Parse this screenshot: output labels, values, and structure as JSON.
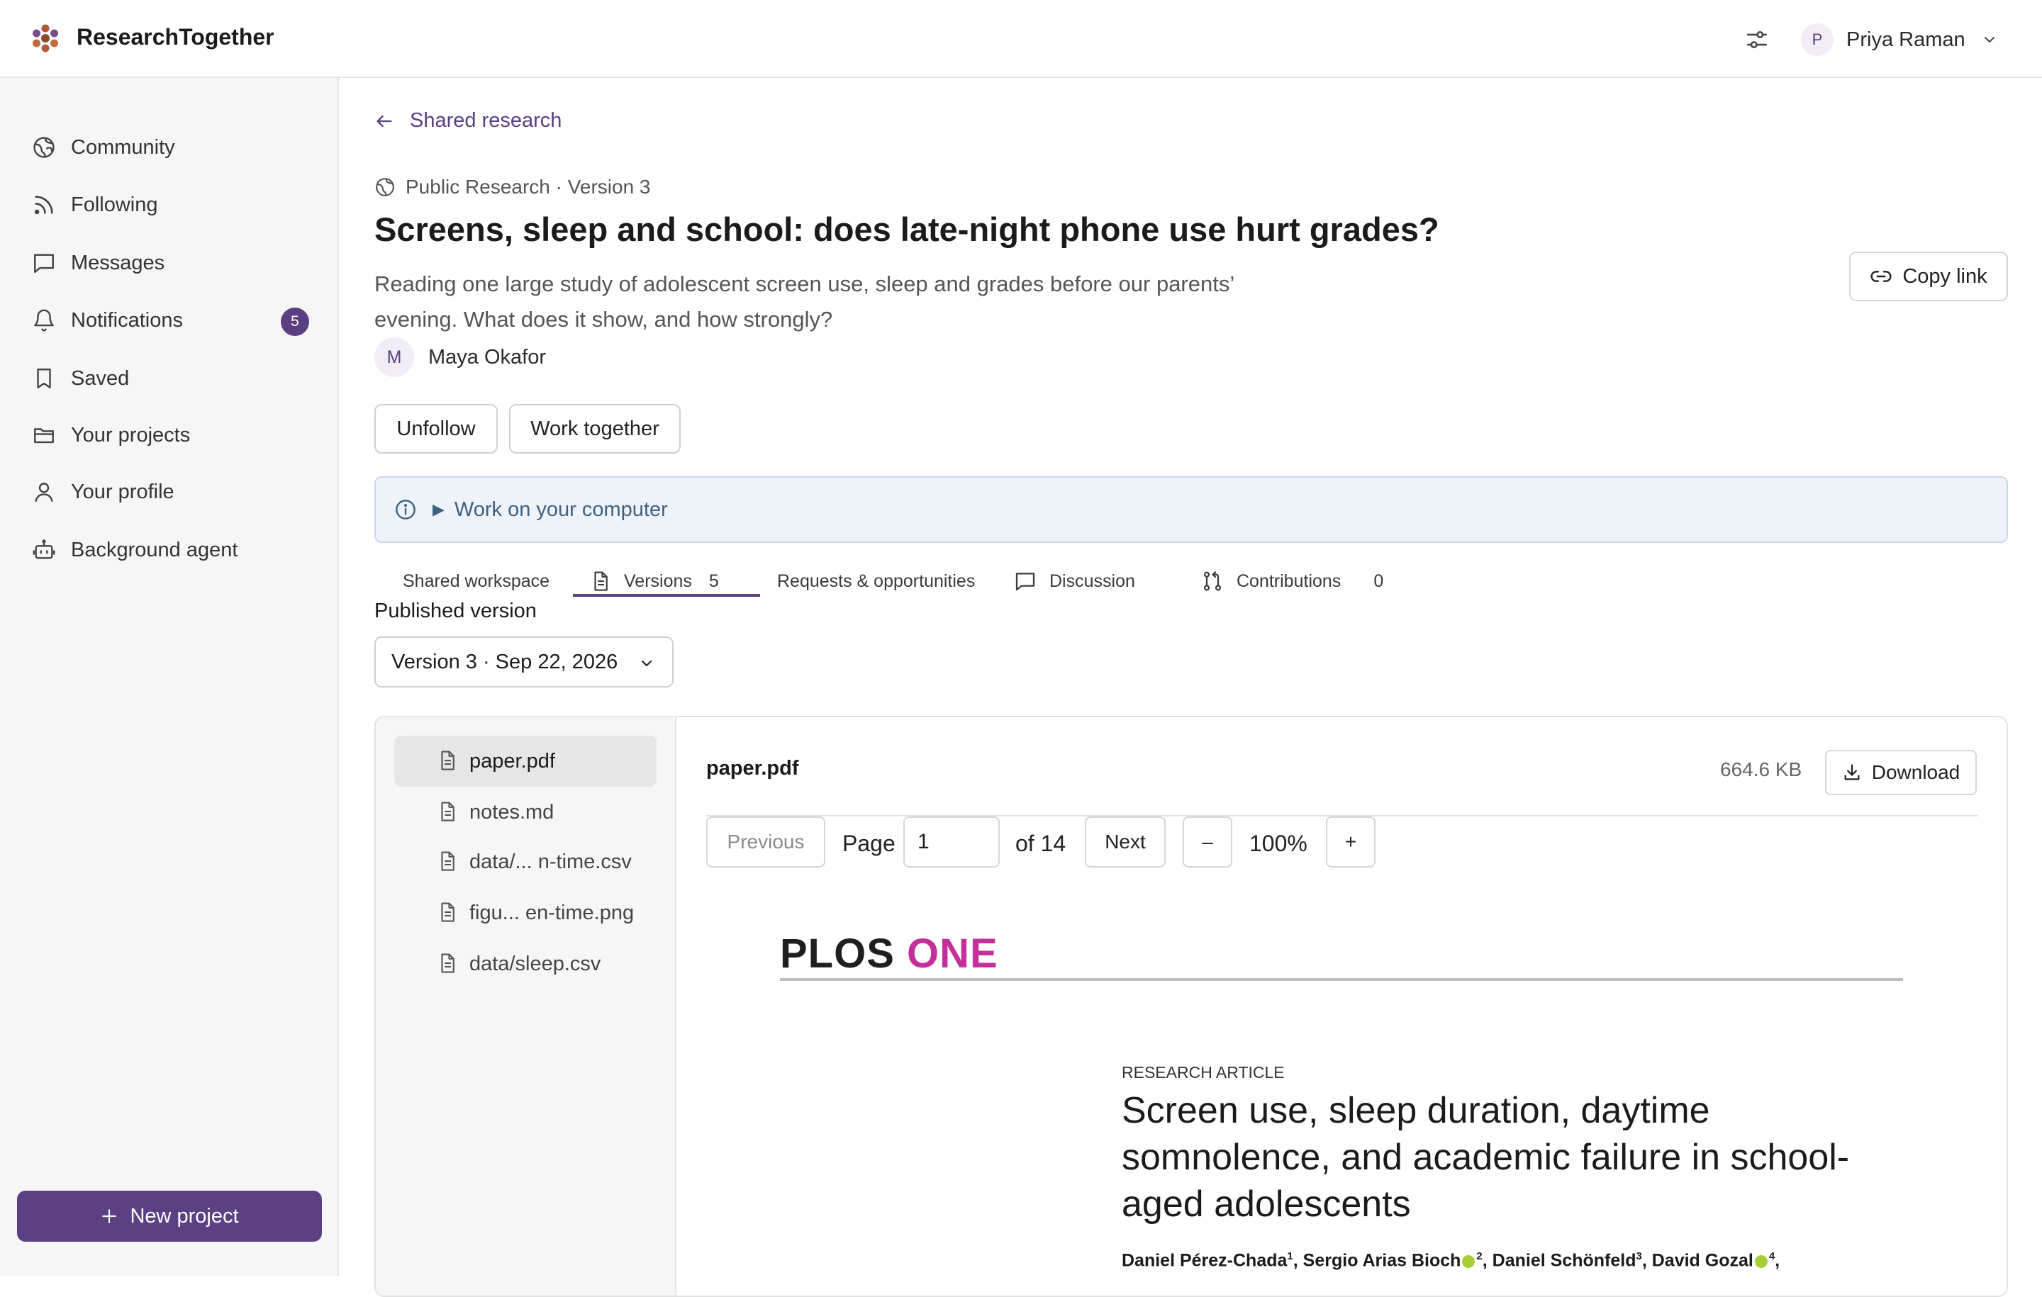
{
  "app": {
    "name": "ResearchTogether"
  },
  "user": {
    "initial": "P",
    "name": "Priya Raman"
  },
  "sidebar": {
    "items": [
      {
        "label": "Community",
        "icon": "globe-icon"
      },
      {
        "label": "Following",
        "icon": "rss-icon"
      },
      {
        "label": "Messages",
        "icon": "message-icon"
      },
      {
        "label": "Notifications",
        "icon": "bell-icon",
        "badge": "5"
      },
      {
        "label": "Saved",
        "icon": "bookmark-icon"
      },
      {
        "label": "Your projects",
        "icon": "folder-icon"
      },
      {
        "label": "Your profile",
        "icon": "user-icon"
      },
      {
        "label": "Background agent",
        "icon": "bot-icon"
      }
    ],
    "new_project_label": "New project"
  },
  "main": {
    "back_label": "Shared research",
    "meta": "Public Research · Version 3",
    "title": "Screens, sleep and school: does late-night phone use hurt grades?",
    "subtitle": "Reading one large study of adolescent screen use, sleep and grades before our parents’ evening. What does it show, and how strongly?",
    "author": {
      "initial": "M",
      "name": "Maya Okafor"
    },
    "copy_link_label": "Copy link",
    "unfollow_label": "Unfollow",
    "work_together_label": "Work together",
    "info_label": "Work on your computer",
    "tabs": [
      {
        "label": "Shared workspace"
      },
      {
        "label": "Versions",
        "count": "5"
      },
      {
        "label": "Requests & opportunities"
      },
      {
        "label": "Discussion"
      },
      {
        "label": "Contributions",
        "count": "0"
      }
    ],
    "published_label": "Published version",
    "version_selected": "Version 3 · Sep 22, 2026"
  },
  "files": [
    {
      "name": "paper.pdf"
    },
    {
      "name": "notes.md"
    },
    {
      "name": "data/... n-time.csv"
    },
    {
      "name": "figu... en-time.png"
    },
    {
      "name": "data/sleep.csv"
    }
  ],
  "viewer": {
    "file_name": "paper.pdf",
    "file_size": "664.6 KB",
    "download_label": "Download",
    "previous_label": "Previous",
    "page_label": "Page",
    "page_value": "1",
    "page_total": "of 14",
    "next_label": "Next",
    "zoom_out_label": "–",
    "zoom_level": "100%",
    "zoom_in_label": "+"
  },
  "pdf": {
    "logo_a": "PLOS",
    "logo_b": "ONE",
    "kicker": "RESEARCH ARTICLE",
    "title": "Screen use, sleep duration, daytime somnolence, and academic failure in school-aged adolescents",
    "authors": [
      {
        "name": "Daniel Pérez-Chada",
        "sup": "1"
      },
      {
        "name": "Sergio Arias Bioch",
        "sup": "2"
      },
      {
        "name": "Daniel Schönfeld",
        "sup": "3"
      },
      {
        "name": "David Gozal",
        "sup": "4"
      }
    ]
  },
  "colors": {
    "accent": "#5b4183",
    "info_bg": "#eef3fa",
    "plos_pink": "#c42f99"
  }
}
